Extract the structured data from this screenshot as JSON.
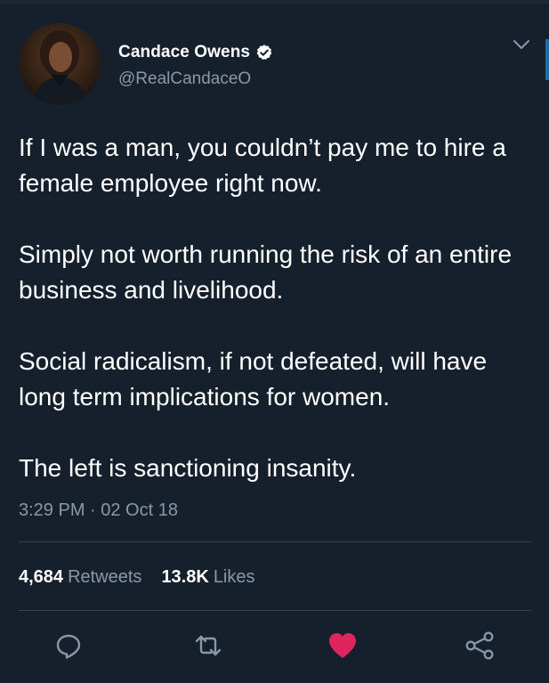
{
  "tweet": {
    "author": {
      "name": "Candace Owens",
      "handle": "@RealCandaceO",
      "verified": true
    },
    "paragraphs": [
      "If I was a man, you couldn’t pay me to hire a female employee right now.",
      "Simply not worth running the risk of an entire business and livelihood.",
      "Social radicalism, if not defeated, will have long term implications for women.",
      "The left is sanctioning insanity."
    ],
    "timestamp": "3:29 PM · 02 Oct 18",
    "stats": {
      "retweets_count": "4,684",
      "retweets_label": "Retweets",
      "likes_count": "13.8K",
      "likes_label": "Likes"
    }
  },
  "actions": {
    "reply_icon": "reply-icon",
    "retweet_icon": "retweet-icon",
    "like_icon": "heart-icon",
    "share_icon": "share-icon",
    "like_active": true
  },
  "colors": {
    "background": "#16202c",
    "text": "#ffffff",
    "secondary_text": "#8899a6",
    "divider": "#38444d",
    "like_active": "#e0245e",
    "verified": "#ffffff"
  }
}
